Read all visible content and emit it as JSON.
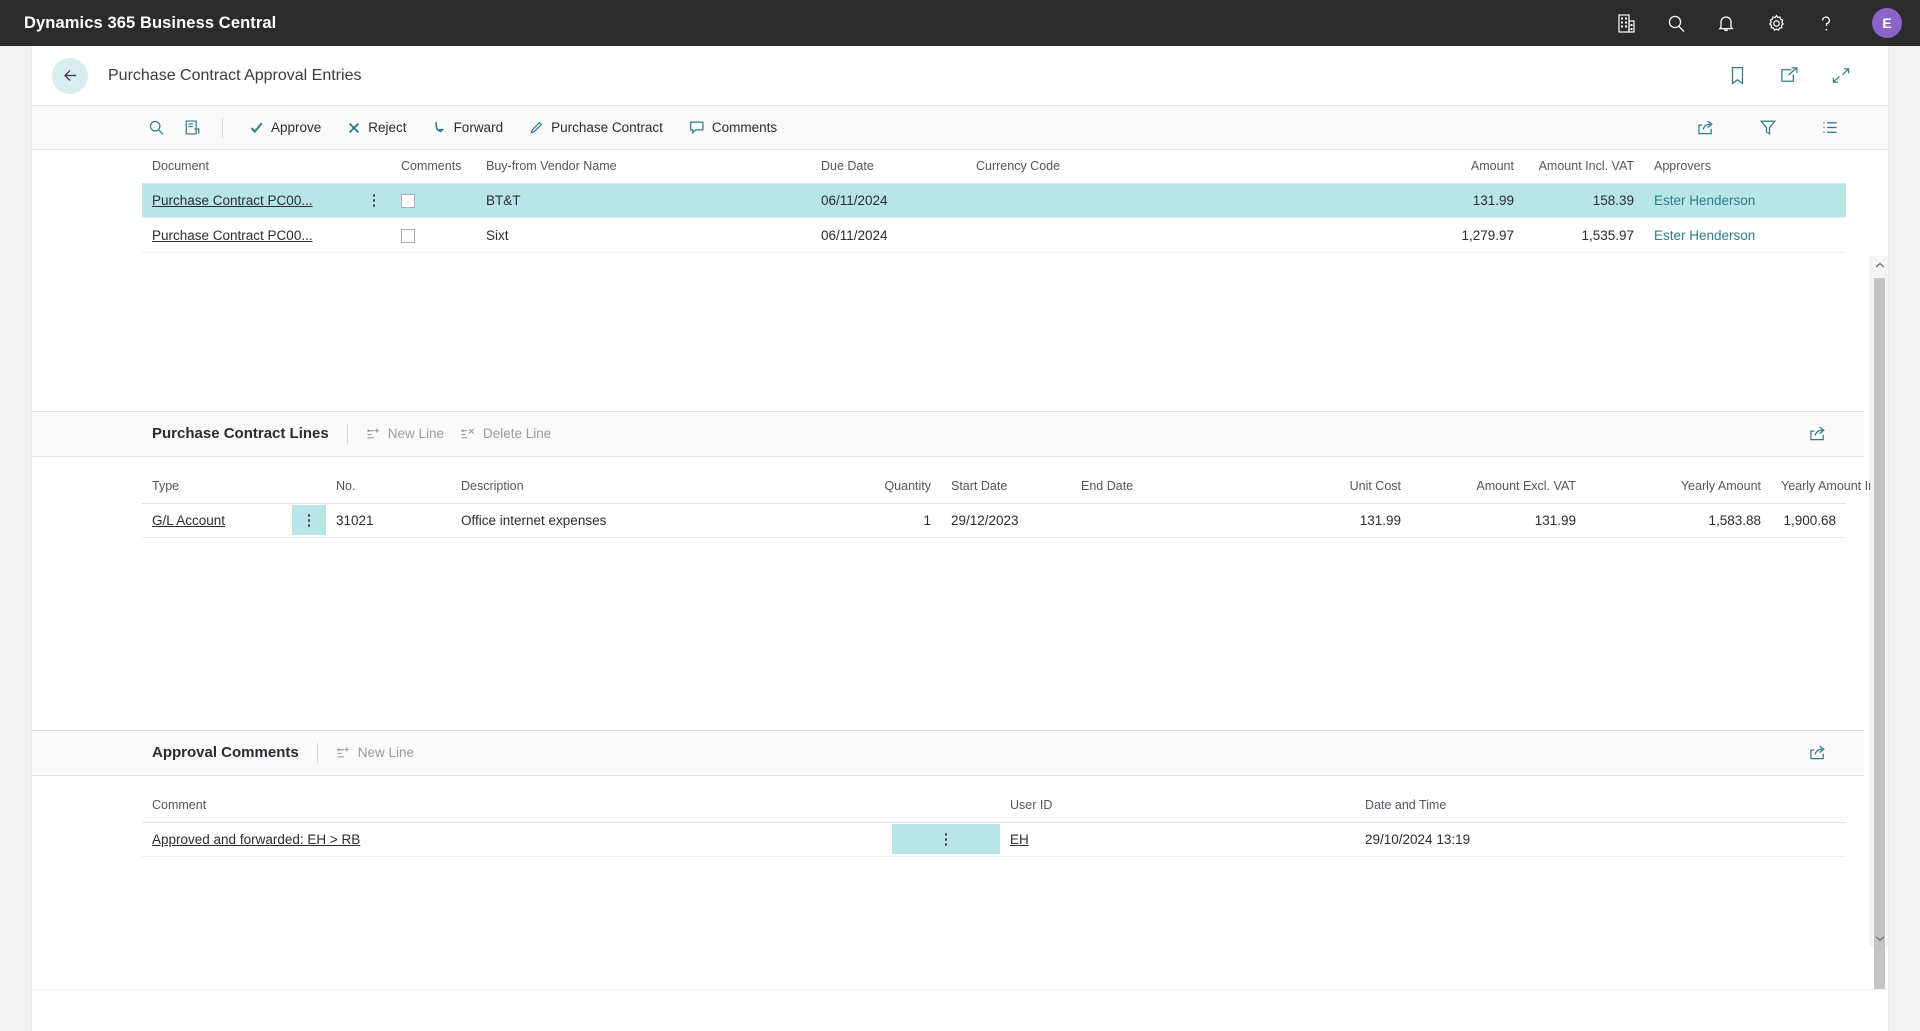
{
  "topbar": {
    "brand": "Dynamics 365 Business Central",
    "icons": [
      {
        "name": "company-icon",
        "glyph": "company"
      },
      {
        "name": "search-icon",
        "glyph": "search"
      },
      {
        "name": "notifications-icon",
        "glyph": "bell"
      },
      {
        "name": "settings-icon",
        "glyph": "gear"
      },
      {
        "name": "help-icon",
        "glyph": "question"
      }
    ],
    "avatar_initial": "E",
    "avatar_color": "#8a64c8"
  },
  "page": {
    "title": "Purchase Contract Approval Entries",
    "back_label": "Back",
    "header_icons": [
      {
        "name": "bookmark-icon",
        "label": "Bookmark"
      },
      {
        "name": "open-in-new-window-icon",
        "label": "Open in new window"
      },
      {
        "name": "collapse-icon",
        "label": "Minimize"
      }
    ]
  },
  "toolbar": {
    "search_label": "Search",
    "card_label": "Open Card",
    "actions": [
      {
        "name": "approve",
        "label": "Approve",
        "icon": "check-icon"
      },
      {
        "name": "reject",
        "label": "Reject",
        "icon": "close-icon"
      },
      {
        "name": "forward",
        "label": "Forward",
        "icon": "arrow-down-icon"
      },
      {
        "name": "purchase-contract",
        "label": "Purchase Contract",
        "icon": "pencil-icon"
      },
      {
        "name": "comments",
        "label": "Comments",
        "icon": "comment-icon"
      }
    ],
    "right_icons": [
      {
        "name": "share-icon",
        "label": "Share"
      },
      {
        "name": "filter-icon",
        "label": "Filter"
      },
      {
        "name": "list-options-icon",
        "label": "List options"
      }
    ]
  },
  "approval_entries": {
    "columns": [
      "Document",
      "Comments",
      "Buy-from Vendor Name",
      "Due Date",
      "Currency Code",
      "Amount",
      "Amount Incl. VAT",
      "Approvers"
    ],
    "rows": [
      {
        "document": "Purchase Contract PC00...",
        "comments_checked": false,
        "vendor": "BT&T",
        "due_date": "06/11/2024",
        "currency_code": "",
        "amount": "131.99",
        "amount_incl_vat": "158.39",
        "approvers": "Ester Henderson",
        "selected": true
      },
      {
        "document": "Purchase Contract PC00...",
        "comments_checked": false,
        "vendor": "Sixt",
        "due_date": "06/11/2024",
        "currency_code": "",
        "amount": "1,279.97",
        "amount_incl_vat": "1,535.97",
        "approvers": "Ester Henderson",
        "selected": false
      }
    ]
  },
  "lines_section": {
    "title": "Purchase Contract Lines",
    "actions": [
      {
        "name": "new-line",
        "label": "New Line",
        "disabled": true
      },
      {
        "name": "delete-line",
        "label": "Delete Line",
        "disabled": true
      }
    ],
    "share_label": "Share",
    "columns": [
      "Type",
      "No.",
      "Description",
      "Quantity",
      "Start Date",
      "End Date",
      "Unit Cost",
      "Amount Excl. VAT",
      "Yearly Amount",
      "Yearly Amount Incl. VAT"
    ],
    "rows": [
      {
        "type": "G/L Account",
        "no": "31021",
        "description": "Office internet expenses",
        "quantity": "1",
        "start_date": "29/12/2023",
        "end_date": "",
        "unit_cost": "131.99",
        "amount_excl_vat": "131.99",
        "yearly_amount": "1,583.88",
        "yearly_amount_incl_vat": "1,900.68"
      }
    ]
  },
  "comments_section": {
    "title": "Approval Comments",
    "actions": [
      {
        "name": "new-line",
        "label": "New Line",
        "disabled": true
      }
    ],
    "share_label": "Share",
    "columns": [
      "Comment",
      "User ID",
      "Date and Time"
    ],
    "rows": [
      {
        "comment": "Approved and forwarded: EH > RB",
        "user_id": "EH",
        "date_time": "29/10/2024 13:19"
      }
    ]
  },
  "colors": {
    "accent_teal": "#2f7c85",
    "selection": "#b8e5e8",
    "topbar_bg": "#2b2b2b"
  }
}
